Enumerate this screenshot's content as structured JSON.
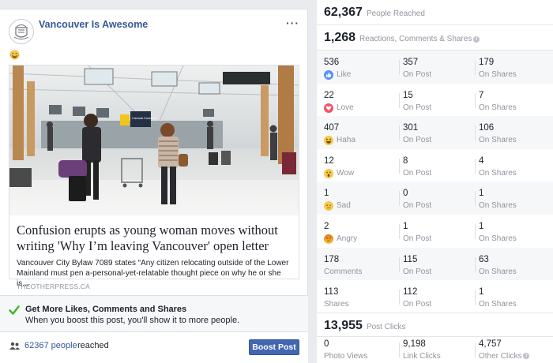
{
  "post": {
    "page_name": "Vancouver Is Awesome",
    "more_label": "···",
    "link": {
      "title": "Confusion erupts as young woman moves without writing 'Why I’m leaving Vancouver' open letter",
      "description": "Vancouver City Bylaw 7089 states “Any citizen relocating outside of the Lower Mainland must pen a-personal-yet-relatable thought piece on why he or she is...",
      "domain": "THEOTHERPRESS.CA",
      "sign_text": "Canada Customs"
    }
  },
  "boost_info": {
    "title": "Get More Likes, Comments and Shares",
    "subtitle": "When you boost this post, you'll show it to more people."
  },
  "reach_bar": {
    "count": "62367 people",
    "label": "reached",
    "boost_button": "Boost Post"
  },
  "insights": {
    "people_reached": {
      "value": "62,367",
      "label": "People Reached"
    },
    "reactions_total": {
      "value": "1,268",
      "label": "Reactions, Comments & Shares",
      "info": "i"
    },
    "rows": [
      {
        "icon": "like-icon",
        "total": "536",
        "label": "Like",
        "on_post": "357",
        "on_post_label": "On Post",
        "on_shares": "179",
        "on_shares_label": "On Shares"
      },
      {
        "icon": "love-icon",
        "total": "22",
        "label": "Love",
        "on_post": "15",
        "on_post_label": "On Post",
        "on_shares": "7",
        "on_shares_label": "On Shares"
      },
      {
        "icon": "haha-icon",
        "total": "407",
        "label": "Haha",
        "on_post": "301",
        "on_post_label": "On Post",
        "on_shares": "106",
        "on_shares_label": "On Shares"
      },
      {
        "icon": "wow-icon",
        "total": "12",
        "label": "Wow",
        "on_post": "8",
        "on_post_label": "On Post",
        "on_shares": "4",
        "on_shares_label": "On Shares"
      },
      {
        "icon": "sad-icon",
        "total": "1",
        "label": "Sad",
        "on_post": "0",
        "on_post_label": "On Post",
        "on_shares": "1",
        "on_shares_label": "On Shares"
      },
      {
        "icon": "angry-icon",
        "total": "2",
        "label": "Angry",
        "on_post": "1",
        "on_post_label": "On Post",
        "on_shares": "1",
        "on_shares_label": "On Shares"
      },
      {
        "icon": "",
        "total": "178",
        "label": "Comments",
        "on_post": "115",
        "on_post_label": "On Post",
        "on_shares": "63",
        "on_shares_label": "On Shares"
      },
      {
        "icon": "",
        "total": "113",
        "label": "Shares",
        "on_post": "112",
        "on_post_label": "On Post",
        "on_shares": "1",
        "on_shares_label": "On Shares"
      }
    ],
    "post_clicks": {
      "value": "13,955",
      "label": "Post Clicks"
    },
    "clicks": [
      {
        "value": "0",
        "label": "Photo Views"
      },
      {
        "value": "9,198",
        "label": "Link Clicks"
      },
      {
        "value": "4,757",
        "label": "Other Clicks",
        "info": "i"
      }
    ]
  },
  "colors": {
    "link_blue": "#365899",
    "button_blue": "#4267b2",
    "like_blue": "#5890ff",
    "love_red": "#f25268",
    "emoji_yellow": "#f7c948",
    "angry_orange": "#e9710f",
    "check_green": "#42b72a"
  }
}
